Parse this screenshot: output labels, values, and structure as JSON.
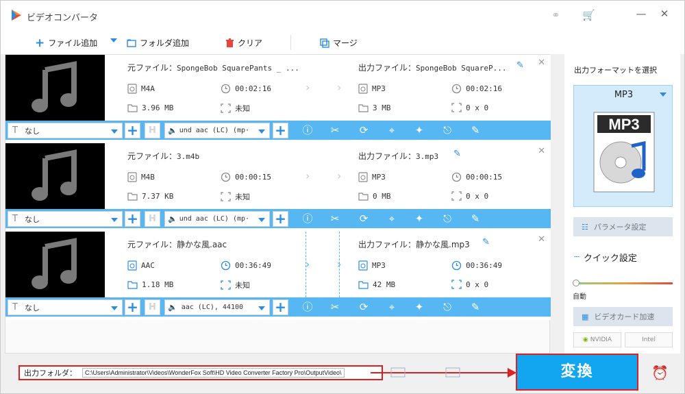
{
  "app": {
    "title": "ビデオコンバータ"
  },
  "toolbar": {
    "add_file": "ファイル追加",
    "add_folder": "フォルダ追加",
    "clear": "クリア",
    "merge": "マージ"
  },
  "items": [
    {
      "source_label": "元ファイル：",
      "source_name": "SpongeBob SquarePants _ ...",
      "src_format": "M4A",
      "src_duration": "00:02:16",
      "src_size": "3.96 MB",
      "src_resolution": "未知",
      "output_label": "出力ファイル：",
      "output_name": "SpongeBob SquareP...",
      "out_format": "MP3",
      "out_duration": "00:02:16",
      "out_size": "3 MB",
      "out_resolution": "0 x 0",
      "subtitle": "なし",
      "audio": "und aac (LC) (mp·"
    },
    {
      "source_label": "元ファイル：",
      "source_name": "3.m4b",
      "src_format": "M4B",
      "src_duration": "00:00:15",
      "src_size": "7.37 KB",
      "src_resolution": "未知",
      "output_label": "出力ファイル：",
      "output_name": "3.mp3",
      "out_format": "MP3",
      "out_duration": "00:00:15",
      "out_size": "0 MB",
      "out_resolution": "0 x 0",
      "subtitle": "なし",
      "audio": "und aac (LC) (mp·"
    },
    {
      "source_label": "元ファイル：",
      "source_name": "静かな風.aac",
      "src_format": "AAC",
      "src_duration": "00:36:49",
      "src_size": "1.18 MB",
      "src_resolution": "未知",
      "output_label": "出力ファイル：",
      "output_name": "静かな風.mp3",
      "out_format": "MP3",
      "out_duration": "00:36:49",
      "out_size": "42 MB",
      "out_resolution": "0 x 0",
      "subtitle": "なし",
      "audio": "aac (LC), 44100"
    }
  ],
  "right_panel": {
    "select_format_label": "出力フォーマットを選択",
    "format": "MP3",
    "format_icon_text": "MP3",
    "param_settings": "パラメータ設定",
    "quick_settings": "クイック設定",
    "auto_label": "自動",
    "gpu_accel": "ビデオカード加速",
    "nvidia": "NVIDIA",
    "intel": "Intel"
  },
  "bottom": {
    "output_folder_label": "出力フォルダ：",
    "output_path": "C:\\Users\\Administrator\\Videos\\WonderFox Soft\\HD Video Converter Factory Pro\\OutputVideo\\",
    "convert_label": "変換"
  },
  "colors": {
    "accent": "#2a8be0",
    "ctrl_bar": "#56b7f2",
    "convert_bg": "#12a5f0",
    "highlight": "#e02020"
  }
}
